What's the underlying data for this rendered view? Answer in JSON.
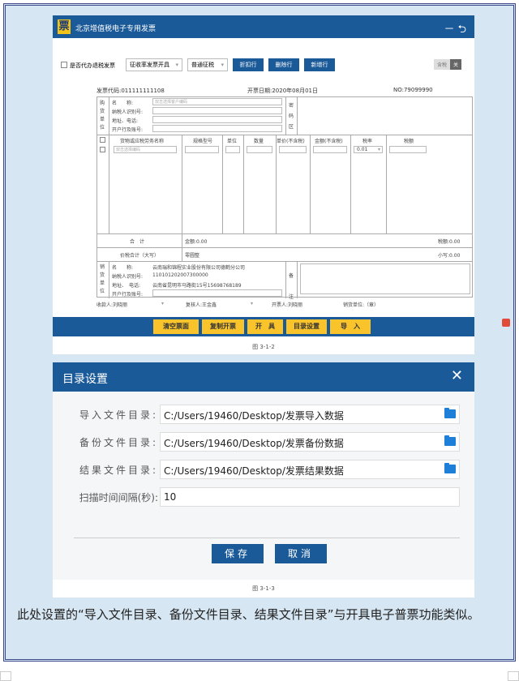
{
  "app": {
    "title": "北京增值税电子专用发票",
    "logo_char": "票",
    "window_controls": "－ ⮌"
  },
  "toolbar": {
    "agent_checkbox_label": "是否代办退税发票",
    "issue_type": "征收率发票开具",
    "levy_type": "普通征税",
    "buttons": [
      "折扣行",
      "删除行",
      "新增行"
    ],
    "tax_incl": "含税",
    "tax_excl": "关"
  },
  "invoice": {
    "code_label": "发票代码:011111111108",
    "date_label": "开票日期:2020年08月01日",
    "no_label": "NO:79099990",
    "buyer_side": [
      "购",
      "货",
      "单",
      "位"
    ],
    "buyer_fields": [
      "名　　称:",
      "纳税人识别号:",
      "地址、电话:",
      "开户行及账号:"
    ],
    "buyer_name_placeholder": "双击选择客户编码",
    "cipher_side": [
      "密",
      "码",
      "区"
    ],
    "columns": [
      "货物或应税劳务名称",
      "规格型号",
      "单位",
      "数量",
      "单价(不含税)",
      "金额(不含税)",
      "税率",
      "税额"
    ],
    "item_placeholder": "双击选择编码",
    "rate": "0.01",
    "total_label": "合　计",
    "amount_total": "金额:0.00",
    "tax_total": "税额:0.00",
    "grand_label": "价税合计（大写）",
    "grand_value": "零圆整",
    "grand_small": "小写:0.00",
    "seller_side": [
      "销",
      "货",
      "单",
      "位"
    ],
    "seller_fields": [
      "名　　称:",
      "纳税人识别号:",
      "地址、　电话:",
      "开户行及账号:"
    ],
    "seller_values": [
      "云南瑞和锦程实业股份有限公司德鹤分公司",
      "110101202007300000",
      "云南省昆明市马路街15号15698768189",
      ""
    ],
    "remark_side": [
      "备",
      "注"
    ],
    "payee": "收款人:刘晓丽",
    "reviewer": "复核人:王金鑫",
    "drawer": "开票人:刘晓丽",
    "seller_unit": "销货单位:（章）"
  },
  "actions": [
    "清空票面",
    "复制开票",
    "开　具",
    "目录设置",
    "导　入"
  ],
  "caption1": "图 3-1-2",
  "dialog": {
    "title": "目录设置",
    "close": "✕",
    "fields": [
      {
        "label": "导入文件目录:",
        "value": "C:/Users/19460/Desktop/发票导入数据"
      },
      {
        "label": "备份文件目录:",
        "value": "C:/Users/19460/Desktop/发票备份数据"
      },
      {
        "label": "结果文件目录:",
        "value": "C:/Users/19460/Desktop/发票结果数据"
      },
      {
        "label": "扫描时间间隔(秒):",
        "value": "10"
      }
    ],
    "save": "保存",
    "cancel": "取消"
  },
  "caption2": "图 3-1-3",
  "paragraph": "此处设置的“导入文件目录、备份文件目录、结果文件目录”与开具电子普票功能类似。",
  "colors": {
    "primary": "#1b5a98",
    "yellow": "#f8c32b",
    "frame_bg": "#d6e6f2"
  }
}
